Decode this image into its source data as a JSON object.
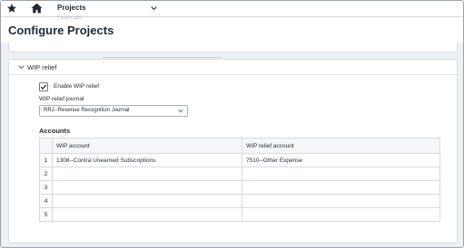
{
  "topbar": {
    "nav_label": "Projects",
    "icons": [
      "star-icon",
      "home-icon",
      "chevron-down-icon"
    ]
  },
  "header": {
    "faded_breadcrumb": "Financials",
    "page_title": "Configure Projects"
  },
  "section": {
    "title": "WIP relief",
    "enable_checkbox": {
      "label": "Enable WIP relief",
      "checked": true
    },
    "journal_field": {
      "label": "WIP relief journal",
      "value": "RRJ--Revenue Recognition Journal"
    },
    "accounts": {
      "heading": "Accounts",
      "columns": [
        "",
        "WIP account",
        "WIP relief account"
      ],
      "rows": [
        {
          "num": "1",
          "wip_account": "1308--Contra Unearned Subscriptions",
          "relief_account": "7510--Other Expense"
        },
        {
          "num": "2",
          "wip_account": "",
          "relief_account": ""
        },
        {
          "num": "3",
          "wip_account": "",
          "relief_account": ""
        },
        {
          "num": "4",
          "wip_account": "",
          "relief_account": ""
        },
        {
          "num": "5",
          "wip_account": "",
          "relief_account": ""
        }
      ]
    }
  },
  "colors": {
    "background": "#eef1f4",
    "card": "#ffffff",
    "border": "#d6dbe0",
    "text": "#1f2a33"
  }
}
